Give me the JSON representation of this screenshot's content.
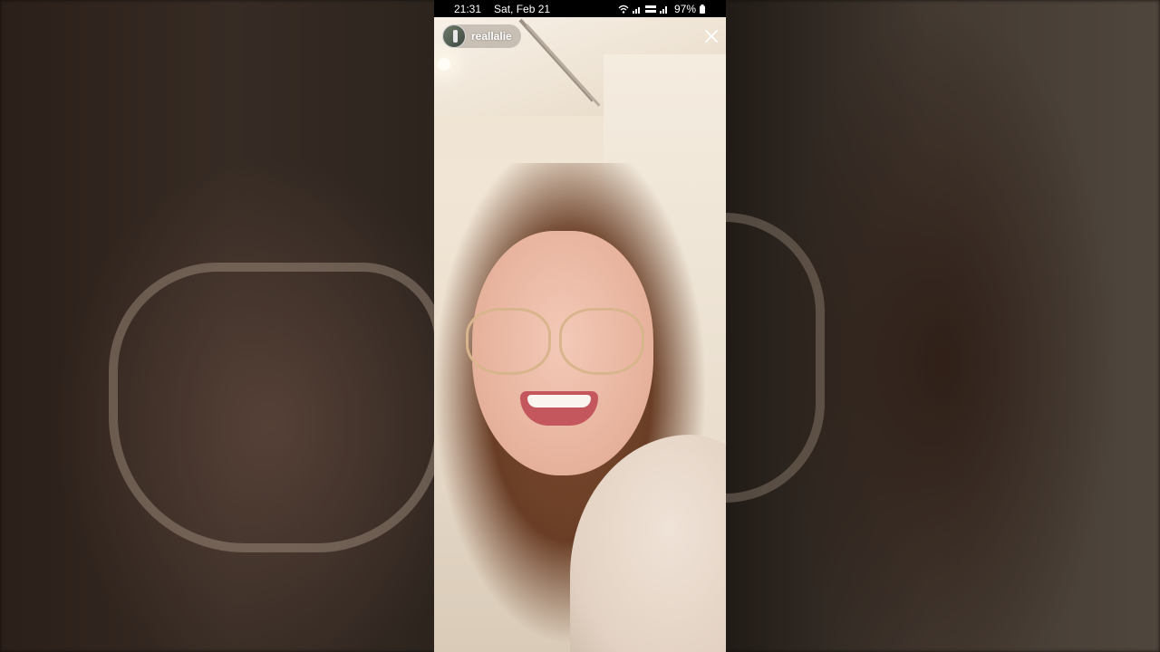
{
  "status_bar": {
    "time": "21:31",
    "date": "Sat, Feb 21",
    "battery_percent": "97%",
    "icons": [
      "wifi-icon",
      "signal-icon",
      "volte-icon",
      "signal-icon",
      "battery-icon"
    ]
  },
  "story": {
    "username": "reallalie",
    "close_icon": "close-icon"
  },
  "colors": {
    "status_bar_bg": "#000000",
    "text": "#ffffff"
  }
}
